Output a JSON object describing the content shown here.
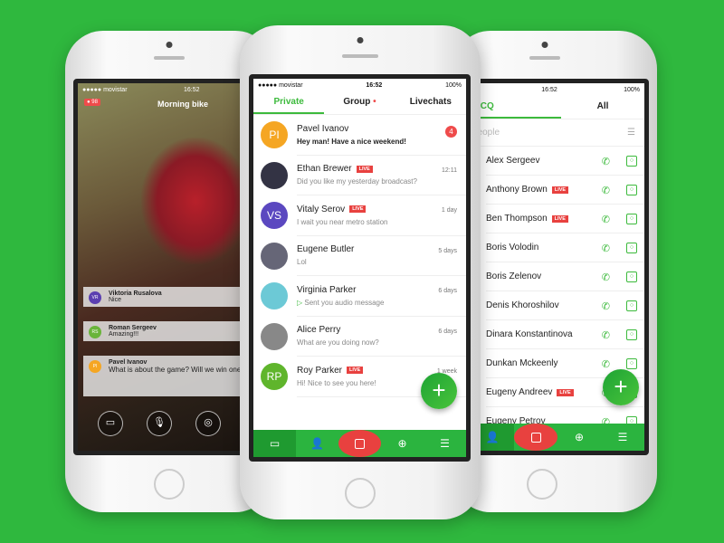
{
  "status": {
    "carrier": "●●●●● movistar",
    "time": "16:52",
    "battery": "100%"
  },
  "left": {
    "viewers": "● 98",
    "title": "Morning bike",
    "messages": [
      {
        "initials": "VR",
        "name": "Viktoria Rusalova",
        "text": "Nice",
        "color": "#5b3fb0"
      },
      {
        "initials": "RS",
        "name": "Roman Sergeev",
        "text": "Amazing!!!",
        "color": "#6ab43a"
      },
      {
        "initials": "PI",
        "name": "Pavel Ivanov",
        "text": "What is about the game? Will we win one?",
        "color": "#f5a623"
      }
    ],
    "icons": [
      "chat-icon",
      "microphone-icon",
      "camera-switch-icon"
    ]
  },
  "middle": {
    "tabs": [
      "Private",
      "Group",
      "Livechats"
    ],
    "live_label": "LIVE",
    "chats": [
      {
        "initials": "PI",
        "name": "Pavel Ivanov",
        "text": "Hey man! Have a nice weekend!",
        "time": "",
        "badge": "4",
        "live": false,
        "color": "#f5a623"
      },
      {
        "initials": "",
        "name": "Ethan Brewer",
        "text": "Did you like my yesterday broadcast?",
        "time": "12:11",
        "live": true,
        "color": "#334"
      },
      {
        "initials": "VS",
        "name": "Vitaly Serov",
        "text": "I wait you near metro station",
        "time": "1 day",
        "live": true,
        "color": "#5b48c0"
      },
      {
        "initials": "",
        "name": "Eugene Butler",
        "text": "Lol",
        "time": "5 days",
        "live": false,
        "color": "#667"
      },
      {
        "initials": "",
        "name": "Virginia Parker",
        "text": "Sent you audio message",
        "time": "6 days",
        "live": false,
        "color": "#6cc9d6"
      },
      {
        "initials": "",
        "name": "Alice Perry",
        "text": "What are you doing now?",
        "time": "6 days",
        "live": false,
        "color": "#888"
      },
      {
        "initials": "RP",
        "name": "Roy Parker",
        "text": "Hi! Nice to see you here!",
        "time": "1 week",
        "live": true,
        "color": "#5fb52c"
      }
    ],
    "fab": "+"
  },
  "right": {
    "tabs": [
      "ICQ",
      "All"
    ],
    "search_placeholder": "people",
    "live_label": "LIVE",
    "contacts": [
      {
        "name": "Alex Sergeev",
        "live": false,
        "color": "#f08a2a"
      },
      {
        "name": "Anthony Brown",
        "live": true,
        "color": "#999"
      },
      {
        "name": "Ben Thompson",
        "live": true,
        "color": "#6a4fc8"
      },
      {
        "name": "Boris Volodin",
        "live": false,
        "color": "#223"
      },
      {
        "name": "Boris Zelenov",
        "live": false,
        "color": "#432"
      },
      {
        "name": "Denis Khoroshilov",
        "live": false,
        "color": "#b8902c"
      },
      {
        "name": "Dinara Konstantinova",
        "live": false,
        "color": "#554"
      },
      {
        "name": "Dunkan Mckeenly",
        "live": false,
        "color": "#dde"
      },
      {
        "name": "Eugeny Andreev",
        "live": true,
        "color": "#d42a3a"
      },
      {
        "name": "Eugeny Petrov",
        "live": false,
        "color": "#444"
      }
    ],
    "fab": "+"
  },
  "colors": {
    "background": "#2fb83e",
    "accent": "#3cba3c",
    "live": "#e8413f",
    "nav": "#2bb43f"
  }
}
